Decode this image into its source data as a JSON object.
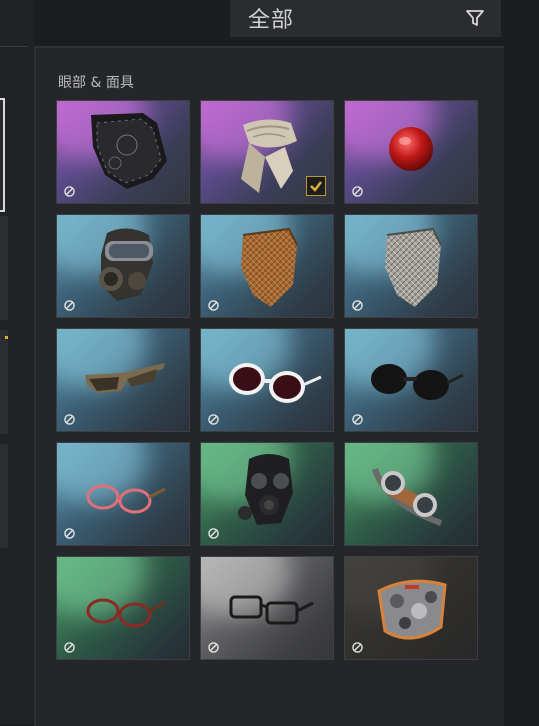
{
  "filter": {
    "label": "全部",
    "icon": "filter-icon"
  },
  "section": {
    "title": "眼部 & 面具"
  },
  "items": [
    {
      "name": "black-bandana-mask",
      "rarity": "purple",
      "equipped": false
    },
    {
      "name": "cream-scarf",
      "rarity": "purple",
      "equipped": true
    },
    {
      "name": "red-clown-nose",
      "rarity": "purple",
      "equipped": false
    },
    {
      "name": "gas-mask-goggles",
      "rarity": "blue",
      "equipped": false
    },
    {
      "name": "tan-shemagh",
      "rarity": "blue",
      "equipped": false
    },
    {
      "name": "grey-shemagh",
      "rarity": "blue",
      "equipped": false
    },
    {
      "name": "tinted-sunglasses",
      "rarity": "blue",
      "equipped": false
    },
    {
      "name": "white-sunglasses",
      "rarity": "blue",
      "equipped": false
    },
    {
      "name": "black-sunglasses",
      "rarity": "blue",
      "equipped": false
    },
    {
      "name": "pink-glasses",
      "rarity": "blue",
      "equipped": false
    },
    {
      "name": "black-gas-mask",
      "rarity": "green",
      "equipped": false
    },
    {
      "name": "aviator-goggles",
      "rarity": "green",
      "equipped": false
    },
    {
      "name": "red-glasses",
      "rarity": "green",
      "equipped": false
    },
    {
      "name": "black-glasses",
      "rarity": "grey",
      "equipped": false
    },
    {
      "name": "camo-face-mask",
      "rarity": "dark",
      "equipped": false
    }
  ],
  "colors": {
    "accent": "#e0b035",
    "panel": "#25262a"
  }
}
